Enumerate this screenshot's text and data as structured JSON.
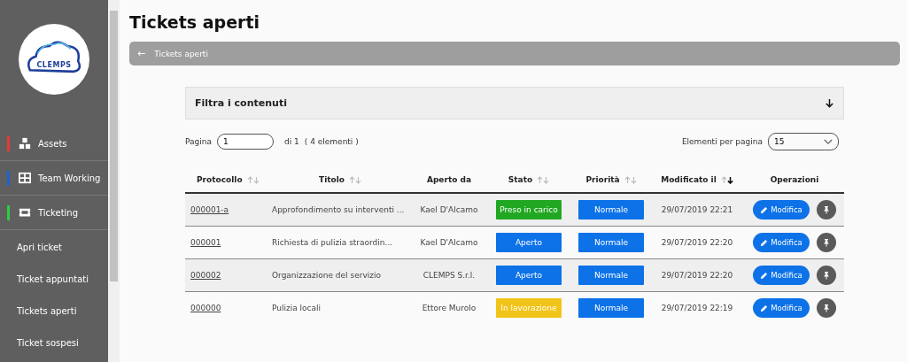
{
  "sidebar": {
    "logo_text": "CLEMPS",
    "menu": [
      {
        "label": "Assets",
        "color": "#e53935",
        "kind": "boxes"
      },
      {
        "label": "Team Working",
        "color": "#1e62d0",
        "kind": "grid"
      },
      {
        "label": "Ticketing",
        "color": "#2ecc40",
        "kind": "ticket",
        "children": [
          {
            "label": "Apri ticket"
          },
          {
            "label": "Ticket appuntati"
          },
          {
            "label": "Tickets aperti"
          },
          {
            "label": "Ticket sospesi"
          }
        ]
      }
    ]
  },
  "page_title": "Tickets aperti",
  "breadcrumb": {
    "back": "←",
    "label": "Tickets aperti"
  },
  "filter": {
    "label": "Filtra i contenuti",
    "expanded": false
  },
  "pagination": {
    "label": "Pagina",
    "page": "1",
    "of": "di 1",
    "count": "( 4 elementi )",
    "per_page_label": "Elementi per pagina",
    "per_page": "15"
  },
  "table": {
    "columns": [
      {
        "label": "Protocollo",
        "sortable": true,
        "sorted": false
      },
      {
        "label": "Titolo",
        "sortable": true,
        "sorted": false
      },
      {
        "label": "Aperto da",
        "sortable": false
      },
      {
        "label": "Stato",
        "sortable": true,
        "sorted": false
      },
      {
        "label": "Priorità",
        "sortable": true,
        "sorted": false
      },
      {
        "label": "Modificato il",
        "sortable": true,
        "sorted": true
      },
      {
        "label": "Operazioni",
        "sortable": false
      }
    ],
    "rows": [
      {
        "protocol": "000001-a",
        "title": "Approfondimento su interventi ...",
        "opened_by": "Kael D'Alcamo",
        "status": {
          "label": "Preso in carico",
          "color": "#22a722"
        },
        "priority": {
          "label": "Normale",
          "color": "#0d72e8"
        },
        "modified": "29/07/2019 22:21",
        "edit": "Modifica"
      },
      {
        "protocol": "000001",
        "title": "Richiesta di pulizia straordin...",
        "opened_by": "Kael D'Alcamo",
        "status": {
          "label": "Aperto",
          "color": "#0d72e8"
        },
        "priority": {
          "label": "Normale",
          "color": "#0d72e8"
        },
        "modified": "29/07/2019 22:20",
        "edit": "Modifica"
      },
      {
        "protocol": "000002",
        "title": "Organizzazione del servizio",
        "opened_by": "CLEMPS S.r.l.",
        "status": {
          "label": "Aperto",
          "color": "#0d72e8"
        },
        "priority": {
          "label": "Normale",
          "color": "#0d72e8"
        },
        "modified": "29/07/2019 22:20",
        "edit": "Modifica"
      },
      {
        "protocol": "000000",
        "title": "Pulizia locali",
        "opened_by": "Ettore Murolo",
        "status": {
          "label": "In lavorazione",
          "color": "#f2c318"
        },
        "priority": {
          "label": "Normale",
          "color": "#0d72e8"
        },
        "modified": "29/07/2019 22:19",
        "edit": "Modifica"
      }
    ]
  }
}
